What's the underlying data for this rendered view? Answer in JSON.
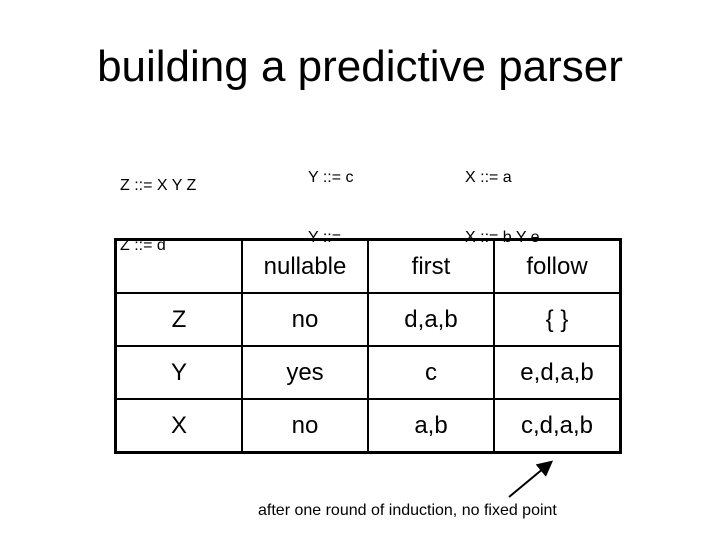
{
  "title": "building a predictive parser",
  "grammar": {
    "z_rules": [
      "Z ::= X Y Z",
      "Z ::= d"
    ],
    "y_rules": [
      "Y ::= c",
      "Y ::="
    ],
    "x_rules": [
      "X ::= a",
      "X ::= b Y e"
    ]
  },
  "table": {
    "headers": [
      "",
      "nullable",
      "first",
      "follow"
    ],
    "rows": [
      [
        "Z",
        "no",
        "d,a,b",
        "{ }"
      ],
      [
        "Y",
        "yes",
        "c",
        "e,d,a,b"
      ],
      [
        "X",
        "no",
        "a,b",
        "c,d,a,b"
      ]
    ]
  },
  "annotation": "after one round of induction, no fixed point"
}
